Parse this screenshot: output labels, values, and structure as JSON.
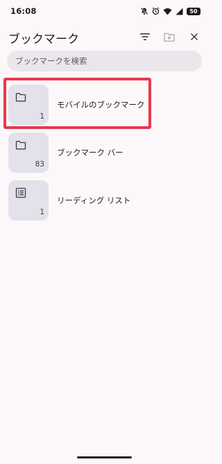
{
  "status_bar": {
    "time": "16:08",
    "battery": "50",
    "icons": [
      "mute-icon",
      "alarm-icon",
      "wifi-icon",
      "signal-icon",
      "battery-icon"
    ]
  },
  "header": {
    "title": "ブックマーク",
    "actions": [
      "filter-icon",
      "new-folder-icon",
      "close-icon"
    ]
  },
  "search": {
    "placeholder": "ブックマークを検索"
  },
  "bookmarks": [
    {
      "label": "モバイルのブックマーク",
      "count": "1",
      "icon": "folder-icon"
    },
    {
      "label": "ブックマーク バー",
      "count": "83",
      "icon": "folder-icon"
    },
    {
      "label": "リーディング リスト",
      "count": "1",
      "icon": "reading-list-icon"
    }
  ],
  "colors": {
    "background": "#fcf8f9",
    "search_fill": "#eae6eb",
    "thumb_fill": "#e3e1ea",
    "highlight": "#e8384f",
    "text": "#1c1b1f"
  }
}
